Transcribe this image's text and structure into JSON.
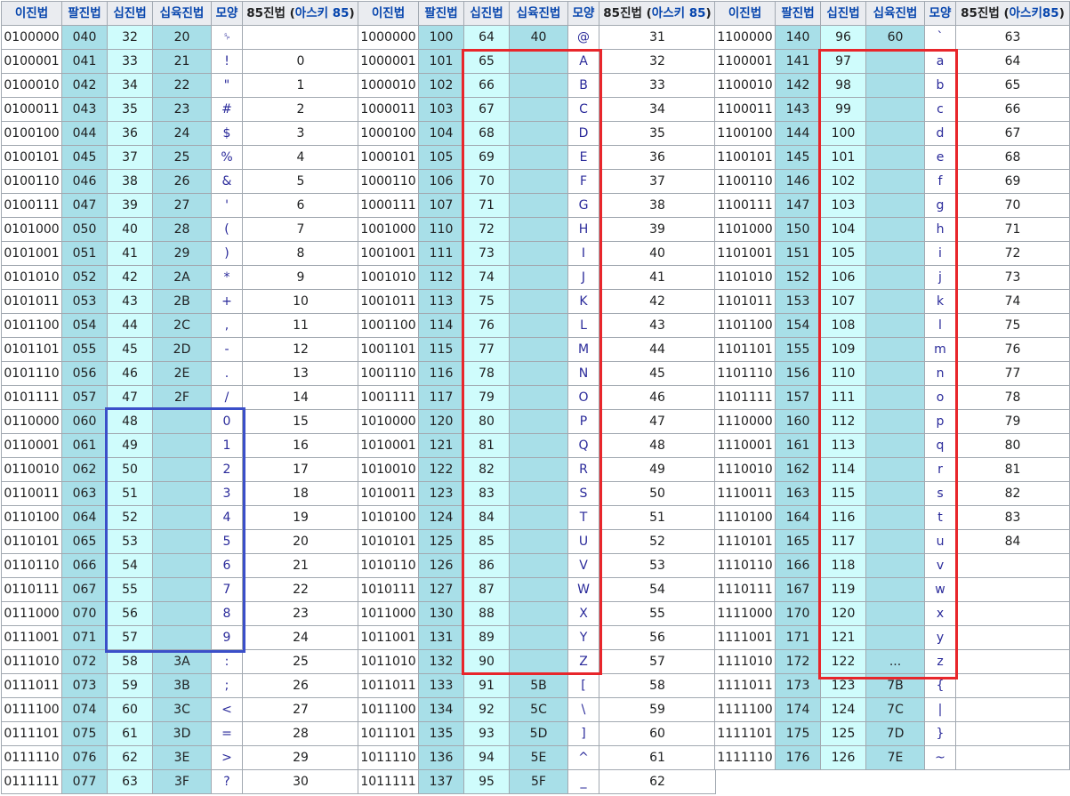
{
  "header": {
    "binary": "이진법",
    "octal": "팔진법",
    "decimal": "십진법",
    "hex": "십육진법",
    "glyph": "모양",
    "base85_prefix": "85진법 (",
    "base85_link": "아스키 85",
    "base85_suffix": ")",
    "base85_third_prefix": "85진법 (",
    "base85_third_link": "아스키85",
    "base85_third_suffix": ")"
  },
  "tables": [
    {
      "rows": [
        [
          "0100000",
          "040",
          "32",
          "20",
          "␠",
          ""
        ],
        [
          "0100001",
          "041",
          "33",
          "21",
          "!",
          "0"
        ],
        [
          "0100010",
          "042",
          "34",
          "22",
          "\"",
          "1"
        ],
        [
          "0100011",
          "043",
          "35",
          "23",
          "#",
          "2"
        ],
        [
          "0100100",
          "044",
          "36",
          "24",
          "$",
          "3"
        ],
        [
          "0100101",
          "045",
          "37",
          "25",
          "%",
          "4"
        ],
        [
          "0100110",
          "046",
          "38",
          "26",
          "&",
          "5"
        ],
        [
          "0100111",
          "047",
          "39",
          "27",
          "'",
          "6"
        ],
        [
          "0101000",
          "050",
          "40",
          "28",
          "(",
          "7"
        ],
        [
          "0101001",
          "051",
          "41",
          "29",
          ")",
          "8"
        ],
        [
          "0101010",
          "052",
          "42",
          "2A",
          "*",
          "9"
        ],
        [
          "0101011",
          "053",
          "43",
          "2B",
          "+",
          "10"
        ],
        [
          "0101100",
          "054",
          "44",
          "2C",
          ",",
          "11"
        ],
        [
          "0101101",
          "055",
          "45",
          "2D",
          "-",
          "12"
        ],
        [
          "0101110",
          "056",
          "46",
          "2E",
          ".",
          "13"
        ],
        [
          "0101111",
          "057",
          "47",
          "2F",
          "/",
          "14"
        ],
        [
          "0110000",
          "060",
          "48",
          "",
          "0",
          "15"
        ],
        [
          "0110001",
          "061",
          "49",
          "",
          "1",
          "16"
        ],
        [
          "0110010",
          "062",
          "50",
          "",
          "2",
          "17"
        ],
        [
          "0110011",
          "063",
          "51",
          "",
          "3",
          "18"
        ],
        [
          "0110100",
          "064",
          "52",
          "",
          "4",
          "19"
        ],
        [
          "0110101",
          "065",
          "53",
          "",
          "5",
          "20"
        ],
        [
          "0110110",
          "066",
          "54",
          "",
          "6",
          "21"
        ],
        [
          "0110111",
          "067",
          "55",
          "",
          "7",
          "22"
        ],
        [
          "0111000",
          "070",
          "56",
          "",
          "8",
          "23"
        ],
        [
          "0111001",
          "071",
          "57",
          "",
          "9",
          "24"
        ],
        [
          "0111010",
          "072",
          "58",
          "3A",
          ":",
          "25"
        ],
        [
          "0111011",
          "073",
          "59",
          "3B",
          ";",
          "26"
        ],
        [
          "0111100",
          "074",
          "60",
          "3C",
          "<",
          "27"
        ],
        [
          "0111101",
          "075",
          "61",
          "3D",
          "=",
          "28"
        ],
        [
          "0111110",
          "076",
          "62",
          "3E",
          ">",
          "29"
        ],
        [
          "0111111",
          "077",
          "63",
          "3F",
          "?",
          "30"
        ]
      ]
    },
    {
      "rows": [
        [
          "1000000",
          "100",
          "64",
          "40",
          "@",
          "31"
        ],
        [
          "1000001",
          "101",
          "65",
          "",
          "A",
          "32"
        ],
        [
          "1000010",
          "102",
          "66",
          "",
          "B",
          "33"
        ],
        [
          "1000011",
          "103",
          "67",
          "",
          "C",
          "34"
        ],
        [
          "1000100",
          "104",
          "68",
          "",
          "D",
          "35"
        ],
        [
          "1000101",
          "105",
          "69",
          "",
          "E",
          "36"
        ],
        [
          "1000110",
          "106",
          "70",
          "",
          "F",
          "37"
        ],
        [
          "1000111",
          "107",
          "71",
          "",
          "G",
          "38"
        ],
        [
          "1001000",
          "110",
          "72",
          "",
          "H",
          "39"
        ],
        [
          "1001001",
          "111",
          "73",
          "",
          "I",
          "40"
        ],
        [
          "1001010",
          "112",
          "74",
          "",
          "J",
          "41"
        ],
        [
          "1001011",
          "113",
          "75",
          "",
          "K",
          "42"
        ],
        [
          "1001100",
          "114",
          "76",
          "",
          "L",
          "43"
        ],
        [
          "1001101",
          "115",
          "77",
          "",
          "M",
          "44"
        ],
        [
          "1001110",
          "116",
          "78",
          "",
          "N",
          "45"
        ],
        [
          "1001111",
          "117",
          "79",
          "",
          "O",
          "46"
        ],
        [
          "1010000",
          "120",
          "80",
          "",
          "P",
          "47"
        ],
        [
          "1010001",
          "121",
          "81",
          "",
          "Q",
          "48"
        ],
        [
          "1010010",
          "122",
          "82",
          "",
          "R",
          "49"
        ],
        [
          "1010011",
          "123",
          "83",
          "",
          "S",
          "50"
        ],
        [
          "1010100",
          "124",
          "84",
          "",
          "T",
          "51"
        ],
        [
          "1010101",
          "125",
          "85",
          "",
          "U",
          "52"
        ],
        [
          "1010110",
          "126",
          "86",
          "",
          "V",
          "53"
        ],
        [
          "1010111",
          "127",
          "87",
          "",
          "W",
          "54"
        ],
        [
          "1011000",
          "130",
          "88",
          "",
          "X",
          "55"
        ],
        [
          "1011001",
          "131",
          "89",
          "",
          "Y",
          "56"
        ],
        [
          "1011010",
          "132",
          "90",
          "",
          "Z",
          "57"
        ],
        [
          "1011011",
          "133",
          "91",
          "5B",
          "[",
          "58"
        ],
        [
          "1011100",
          "134",
          "92",
          "5C",
          "\\",
          "59"
        ],
        [
          "1011101",
          "135",
          "93",
          "5D",
          "]",
          "60"
        ],
        [
          "1011110",
          "136",
          "94",
          "5E",
          "^",
          "61"
        ],
        [
          "1011111",
          "137",
          "95",
          "5F",
          "_",
          "62"
        ]
      ]
    },
    {
      "rows": [
        [
          "1100000",
          "140",
          "96",
          "60",
          "`",
          "63"
        ],
        [
          "1100001",
          "141",
          "97",
          "",
          "a",
          "64"
        ],
        [
          "1100010",
          "142",
          "98",
          "",
          "b",
          "65"
        ],
        [
          "1100011",
          "143",
          "99",
          "",
          "c",
          "66"
        ],
        [
          "1100100",
          "144",
          "100",
          "",
          "d",
          "67"
        ],
        [
          "1100101",
          "145",
          "101",
          "",
          "e",
          "68"
        ],
        [
          "1100110",
          "146",
          "102",
          "",
          "f",
          "69"
        ],
        [
          "1100111",
          "147",
          "103",
          "",
          "g",
          "70"
        ],
        [
          "1101000",
          "150",
          "104",
          "",
          "h",
          "71"
        ],
        [
          "1101001",
          "151",
          "105",
          "",
          "i",
          "72"
        ],
        [
          "1101010",
          "152",
          "106",
          "",
          "j",
          "73"
        ],
        [
          "1101011",
          "153",
          "107",
          "",
          "k",
          "74"
        ],
        [
          "1101100",
          "154",
          "108",
          "",
          "l",
          "75"
        ],
        [
          "1101101",
          "155",
          "109",
          "",
          "m",
          "76"
        ],
        [
          "1101110",
          "156",
          "110",
          "",
          "n",
          "77"
        ],
        [
          "1101111",
          "157",
          "111",
          "",
          "o",
          "78"
        ],
        [
          "1110000",
          "160",
          "112",
          "",
          "p",
          "79"
        ],
        [
          "1110001",
          "161",
          "113",
          "",
          "q",
          "80"
        ],
        [
          "1110010",
          "162",
          "114",
          "",
          "r",
          "81"
        ],
        [
          "1110011",
          "163",
          "115",
          "",
          "s",
          "82"
        ],
        [
          "1110100",
          "164",
          "116",
          "",
          "t",
          "83"
        ],
        [
          "1110101",
          "165",
          "117",
          "",
          "u",
          "84"
        ],
        [
          "1110110",
          "166",
          "118",
          "",
          "v",
          ""
        ],
        [
          "1110111",
          "167",
          "119",
          "",
          "w",
          ""
        ],
        [
          "1111000",
          "170",
          "120",
          "",
          "x",
          ""
        ],
        [
          "1111001",
          "171",
          "121",
          "",
          "y",
          ""
        ],
        [
          "1111010",
          "172",
          "122",
          "...",
          "z",
          ""
        ],
        [
          "1111011",
          "173",
          "123",
          "7B",
          "{",
          ""
        ],
        [
          "1111100",
          "174",
          "124",
          "7C",
          "|",
          ""
        ],
        [
          "1111101",
          "175",
          "125",
          "7D",
          "}",
          ""
        ],
        [
          "1111110",
          "176",
          "126",
          "7E",
          "~",
          ""
        ]
      ]
    }
  ],
  "colors": {
    "octal_bg": "#a8dfe8",
    "decimal_bg": "#cffcfc",
    "header_bg": "#eaecf0",
    "link": "#0645ad",
    "blue_box": "#3b4fc9",
    "red_box": "#e8262b"
  }
}
